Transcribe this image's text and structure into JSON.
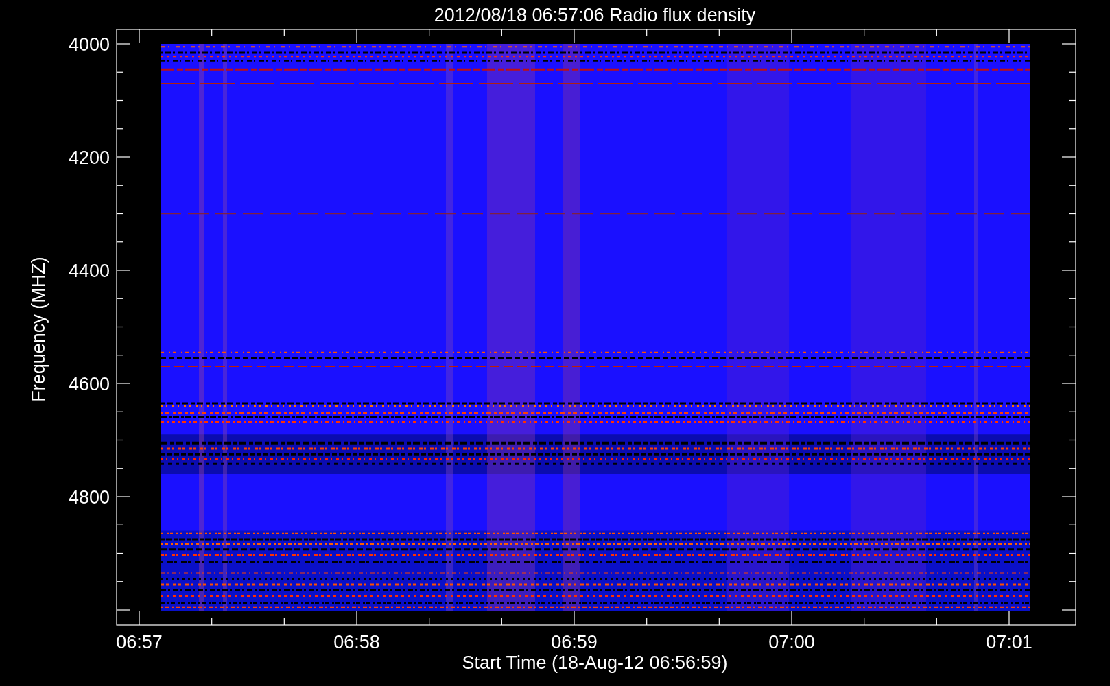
{
  "title": "2012/08/18 06:57:06 Radio flux density",
  "y_axis": {
    "label": "Frequency (MHZ)",
    "ticks": [
      "4000",
      "4200",
      "4400",
      "4600",
      "4800"
    ]
  },
  "x_axis": {
    "label": "Start Time (18-Aug-12 06:56:59)",
    "ticks": [
      "06:57",
      "06:58",
      "06:59",
      "07:00",
      "07:01"
    ]
  }
}
